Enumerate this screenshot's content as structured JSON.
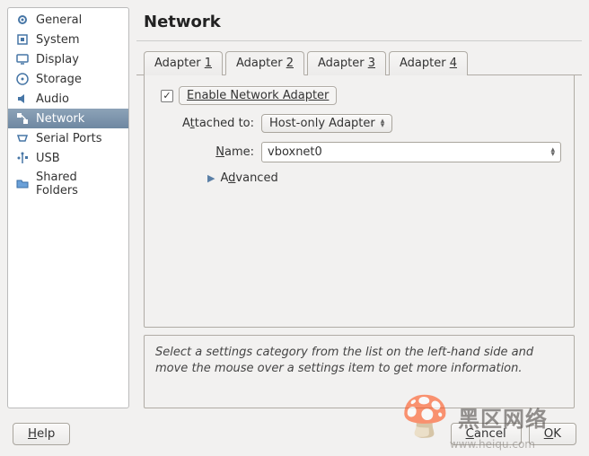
{
  "sidebar": {
    "items": [
      {
        "label": "General",
        "icon": "gear"
      },
      {
        "label": "System",
        "icon": "chip"
      },
      {
        "label": "Display",
        "icon": "monitor"
      },
      {
        "label": "Storage",
        "icon": "disc"
      },
      {
        "label": "Audio",
        "icon": "speaker"
      },
      {
        "label": "Network",
        "icon": "network"
      },
      {
        "label": "Serial Ports",
        "icon": "serial"
      },
      {
        "label": "USB",
        "icon": "usb"
      },
      {
        "label": "Shared Folders",
        "icon": "folder"
      }
    ],
    "selected_index": 5
  },
  "page": {
    "title": "Network"
  },
  "tabs": [
    {
      "prefix": "Adapter ",
      "num": "1"
    },
    {
      "prefix": "Adapter ",
      "num": "2"
    },
    {
      "prefix": "Adapter ",
      "num": "3"
    },
    {
      "prefix": "Adapter ",
      "num": "4"
    }
  ],
  "active_tab": 1,
  "network": {
    "enable_label": "Enable Network Adapter",
    "enabled": true,
    "attached_label_pre": "A",
    "attached_label_u": "t",
    "attached_label_post": "tached to:",
    "attached_value": "Host-only Adapter",
    "name_label_pre": "",
    "name_label_u": "N",
    "name_label_post": "ame:",
    "name_value": "vboxnet0",
    "advanced_label_pre": "A",
    "advanced_label_u": "d",
    "advanced_label_post": "vanced"
  },
  "info": {
    "text": "Select a settings category from the list on the left-hand side and move the mouse over a settings item to get more information."
  },
  "buttons": {
    "help_pre": "",
    "help_u": "H",
    "help_post": "elp",
    "cancel_pre": "",
    "cancel_u": "C",
    "cancel_post": "ancel",
    "ok_pre": "",
    "ok_u": "O",
    "ok_post": "K"
  },
  "watermark": {
    "text": "黑区网络",
    "sub": "www.heiqu.com"
  }
}
